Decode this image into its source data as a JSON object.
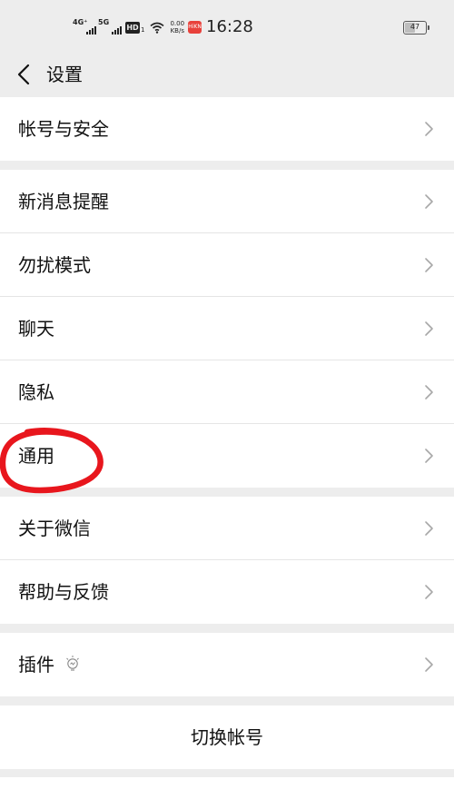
{
  "status_bar": {
    "net1": "4G⁺",
    "net2": "5G",
    "hd": "HD",
    "hd_sub": "1",
    "speed_value": "0.00",
    "speed_unit": "KB/s",
    "app_badge": "HiKN",
    "time": "16:28",
    "battery": "47",
    "battery_level": 0.47
  },
  "nav": {
    "title": "设置",
    "back_icon": "chevron-left-icon"
  },
  "groups": [
    [
      "帐号与安全"
    ],
    [
      "新消息提醒",
      "勿扰模式",
      "聊天",
      "隐私",
      "通用"
    ],
    [
      "关于微信",
      "帮助与反馈"
    ],
    [
      "插件"
    ]
  ],
  "plugin_icon": "lightbulb-icon",
  "switch_account": "切换帐号",
  "highlight": {
    "target": "通用",
    "color": "#e8161d"
  }
}
